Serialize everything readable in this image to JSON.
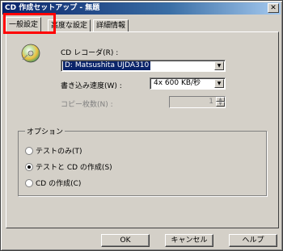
{
  "window": {
    "title": "CD 作成セットアップ - 無題",
    "close_glyph": "✕"
  },
  "tabs": [
    {
      "label": "一般設定",
      "active": true
    },
    {
      "label": "高度な設定",
      "active": false
    },
    {
      "label": "詳細情報",
      "active": false
    }
  ],
  "general": {
    "recorder_label": "CD レコーダ(R) :",
    "recorder_value": "D: Matsushita UJDA310",
    "speed_label": "書き込み速度(W) :",
    "speed_value": "4x 600 KB/秒",
    "copies_label": "コピー枚数(N) :",
    "copies_value": "1"
  },
  "options": {
    "title": "オプション",
    "items": [
      {
        "label": "テストのみ(T)",
        "selected": false
      },
      {
        "label": "テストと CD の作成(S)",
        "selected": true
      },
      {
        "label": "CD の作成(C)",
        "selected": false
      }
    ]
  },
  "buttons": {
    "ok": "OK",
    "cancel": "キャンセル",
    "help": "ヘルプ"
  },
  "colors": {
    "highlight": "#ff0000",
    "titlebar": "#0a246a",
    "selection": "#0a246a"
  },
  "icons": {
    "recorder": "cd-disc-icon"
  }
}
